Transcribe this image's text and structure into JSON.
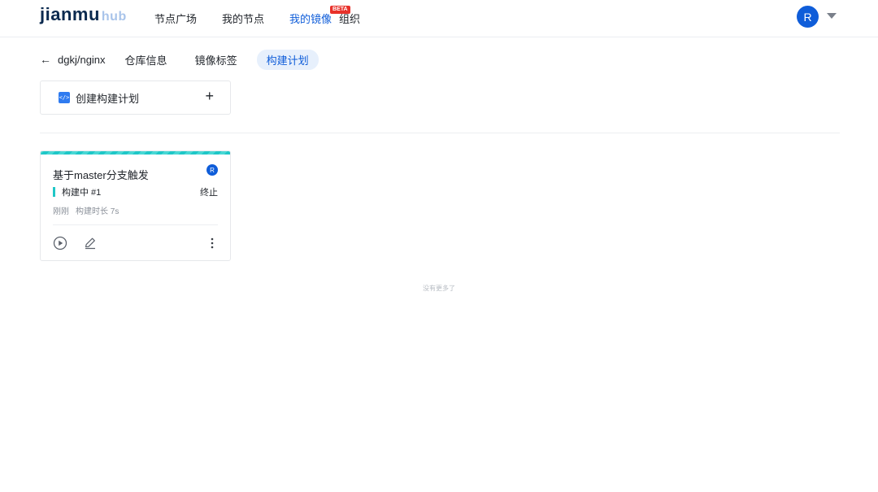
{
  "header": {
    "logo": {
      "main_a": "jian",
      "main_b": "mu",
      "suffix": "hub"
    },
    "nav": [
      {
        "label": "节点广场"
      },
      {
        "label": "我的节点"
      },
      {
        "label": "我的镜像",
        "badge": "BETA"
      },
      {
        "label": "组织"
      }
    ],
    "user_initial": "R"
  },
  "subnav": {
    "repo": "dgkj/nginx",
    "tabs": [
      {
        "label": "仓库信息"
      },
      {
        "label": "镜像标签"
      },
      {
        "label": "构建计划"
      }
    ]
  },
  "create_plan": {
    "label": "创建构建计划",
    "plus": "+"
  },
  "plans": [
    {
      "title": "基于master分支触发",
      "owner_initial": "R",
      "status": "构建中 #1",
      "stop_label": "终止",
      "time": "刚刚",
      "duration": "构建时长 7s"
    }
  ],
  "footer": {
    "no_more": "没有更多了"
  },
  "colors": {
    "accent": "#0f5dd9",
    "building": "#1fc7c7",
    "beta": "#e8312a"
  },
  "icons": [
    "back-arrow-icon",
    "code-icon",
    "plus-icon",
    "play-icon",
    "edit-icon",
    "more-icon",
    "chevron-down-icon"
  ]
}
